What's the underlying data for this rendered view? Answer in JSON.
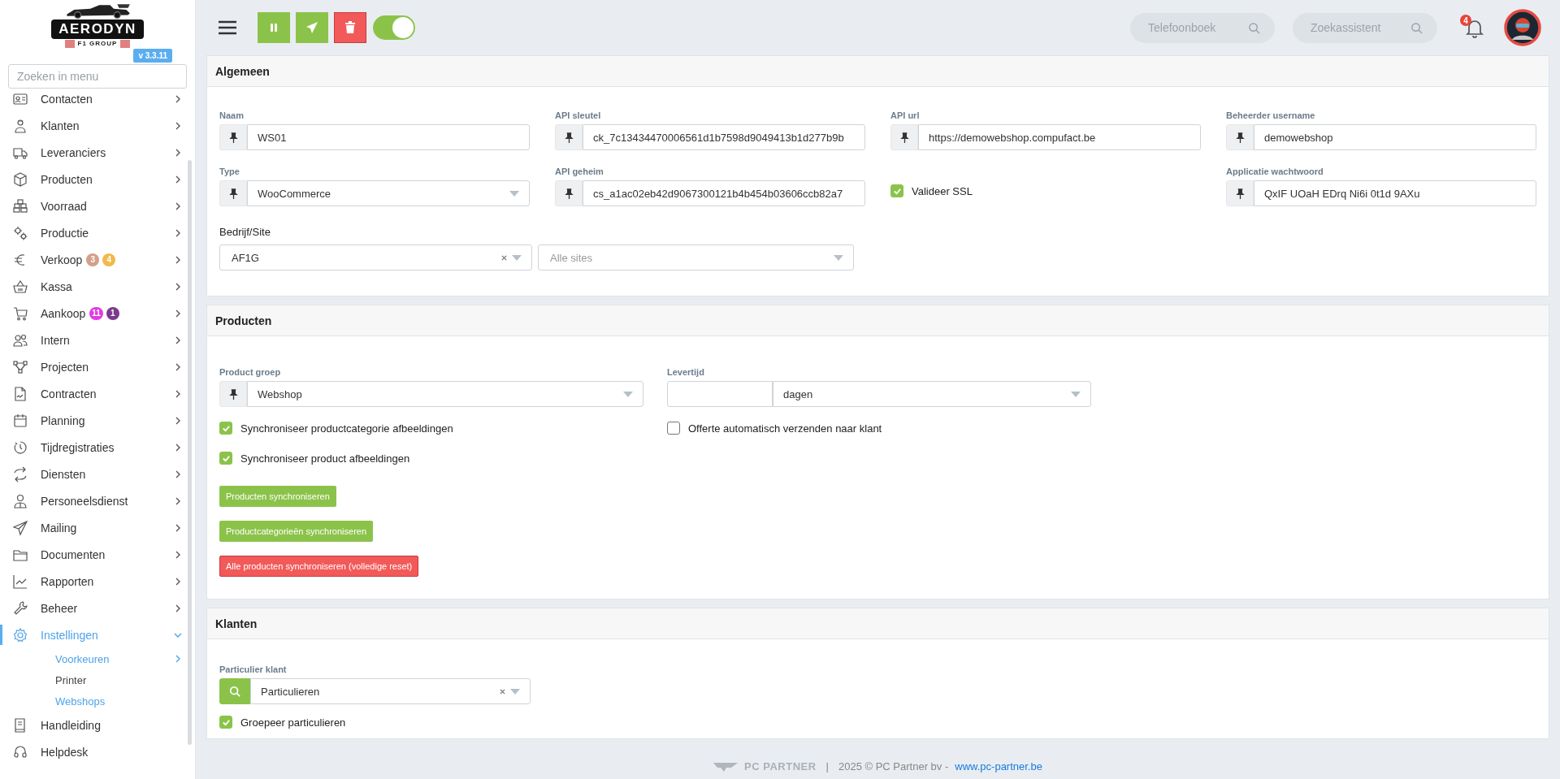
{
  "sidebar": {
    "logo": {
      "name": "AERODYN",
      "subtitle": "F1 GROUP"
    },
    "version": "v 3.3.11",
    "search": {
      "placeholder": "Zoeken in menu"
    },
    "items": [
      {
        "label": "Contacten",
        "kind": "menu",
        "expanded": false,
        "selected": false
      },
      {
        "label": "Klanten",
        "kind": "menu",
        "expanded": false,
        "selected": false
      },
      {
        "label": "Leveranciers",
        "kind": "menu",
        "expanded": false,
        "selected": false
      },
      {
        "label": "Producten",
        "kind": "menu",
        "expanded": false,
        "selected": false
      },
      {
        "label": "Voorraad",
        "kind": "menu",
        "expanded": false,
        "selected": false
      },
      {
        "label": "Productie",
        "kind": "menu",
        "expanded": false,
        "selected": false
      },
      {
        "label": "Verkoop",
        "kind": "menu",
        "expanded": false,
        "selected": false,
        "badges": [
          {
            "text": "3",
            "color": "#d3a08b"
          },
          {
            "text": "4",
            "color": "#f2b84b"
          }
        ]
      },
      {
        "label": "Kassa",
        "kind": "menu",
        "expanded": false,
        "selected": false
      },
      {
        "label": "Aankoop",
        "kind": "menu",
        "expanded": false,
        "selected": false,
        "badges": [
          {
            "text": "11",
            "color": "#e03ce3"
          },
          {
            "text": "1",
            "color": "#7c3a8c"
          }
        ]
      },
      {
        "label": "Intern",
        "kind": "menu",
        "expanded": false,
        "selected": false
      },
      {
        "label": "Projecten",
        "kind": "menu",
        "expanded": false,
        "selected": false
      },
      {
        "label": "Contracten",
        "kind": "menu",
        "expanded": false,
        "selected": false
      },
      {
        "label": "Planning",
        "kind": "menu",
        "expanded": false,
        "selected": false
      },
      {
        "label": "Tijdregistraties",
        "kind": "menu",
        "expanded": false,
        "selected": false
      },
      {
        "label": "Diensten",
        "kind": "menu",
        "expanded": false,
        "selected": false
      },
      {
        "label": "Personeelsdienst",
        "kind": "menu",
        "expanded": false,
        "selected": false
      },
      {
        "label": "Mailing",
        "kind": "menu",
        "expanded": false,
        "selected": false
      },
      {
        "label": "Documenten",
        "kind": "menu",
        "expanded": false,
        "selected": false
      },
      {
        "label": "Rapporten",
        "kind": "menu",
        "expanded": false,
        "selected": false
      },
      {
        "label": "Beheer",
        "kind": "menu",
        "expanded": false,
        "selected": false
      },
      {
        "label": "Instellingen",
        "kind": "menu",
        "expanded": true,
        "selected": true,
        "children": [
          {
            "label": "Voorkeuren",
            "kind": "menu",
            "selected": true
          },
          {
            "label": "Printer",
            "kind": "link",
            "selected": false
          },
          {
            "label": "Webshops",
            "kind": "link",
            "selected": true
          }
        ]
      },
      {
        "label": "Handleiding",
        "kind": "link",
        "selected": false
      },
      {
        "label": "Helpdesk",
        "kind": "link",
        "selected": false
      }
    ]
  },
  "topbar": {
    "toggle": {
      "on": true
    },
    "searches": [
      {
        "placeholder": "Telefoonboek"
      },
      {
        "placeholder": "Zoekassistent"
      }
    ],
    "notifications": "4"
  },
  "algemeen": {
    "title": "Algemeen",
    "fields": [
      {
        "kind": "input",
        "label": "Naam",
        "value": "WS01"
      },
      {
        "kind": "input",
        "label": "API sleutel",
        "value": "ck_7c13434470006561d1b7598d9049413b1d277b9b"
      },
      {
        "kind": "input",
        "label": "API url",
        "value": "https://demowebshop.compufact.be"
      },
      {
        "kind": "input",
        "label": "Beheerder username",
        "value": "demowebshop"
      },
      {
        "kind": "select",
        "label": "Type",
        "value": "WooCommerce"
      },
      {
        "kind": "input",
        "label": "API geheim",
        "value": "cs_a1ac02eb42d9067300121b4b454b03606ccb82a7"
      },
      {
        "kind": "checkbox",
        "label": "Valideer SSL",
        "checked": true
      },
      {
        "kind": "input",
        "label": "Applicatie wachtwoord",
        "value": "QxIF UOaH EDrq Ni6i 0t1d 9AXu"
      }
    ],
    "company_site": {
      "label": "Bedrijf/Site",
      "company": {
        "value": "AF1G",
        "clearable": true
      },
      "site": {
        "placeholder": "Alle sites"
      }
    }
  },
  "producten": {
    "title": "Producten",
    "product_group": {
      "label": "Product groep",
      "value": "Webshop",
      "options": [
        {
          "label": "Synchroniseer productcategorie afbeeldingen",
          "checked": true
        },
        {
          "label": "Synchroniseer product afbeeldingen",
          "checked": true
        }
      ]
    },
    "lead_time": {
      "label": "Levertijd",
      "unit": "dagen",
      "options": [
        {
          "label": "Offerte automatisch verzenden naar klant",
          "checked": false
        }
      ]
    },
    "buttons": [
      {
        "label": "Producten synchroniseren",
        "kind": "primary"
      },
      {
        "label": "Productcategorieën synchroniseren",
        "kind": "primary"
      },
      {
        "label": "Alle producten synchroniseren (volledige reset)",
        "kind": "danger"
      }
    ]
  },
  "klanten": {
    "title": "Klanten",
    "customer": {
      "label": "Particulier klant",
      "value": "Particulieren",
      "clearable": true
    },
    "options": [
      {
        "label": "Groepeer particulieren",
        "checked": true
      }
    ]
  },
  "footer": {
    "brand": "PC PARTNER",
    "separator": "|",
    "copyright": "2025 © PC Partner bv -",
    "link": "www.pc-partner.be"
  }
}
